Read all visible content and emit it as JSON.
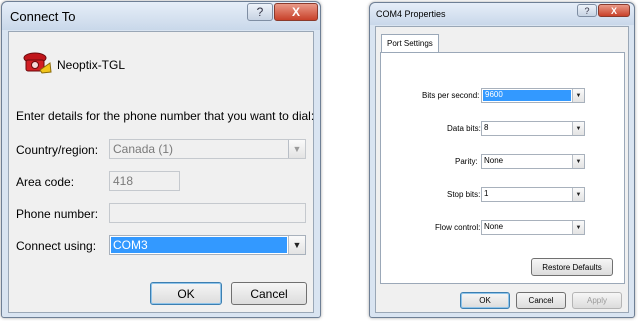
{
  "connect_dialog": {
    "title": "Connect To",
    "help_label": "?",
    "close_label": "X",
    "connection_name": "Neoptix-TGL",
    "instructions": "Enter details for the phone number that you want to dial:",
    "country_label": "Country/region:",
    "country_value": "Canada (1)",
    "area_label": "Area code:",
    "area_value": "418",
    "phone_label": "Phone number:",
    "phone_value": "",
    "connect_label": "Connect using:",
    "connect_value": "COM3",
    "ok_label": "OK",
    "cancel_label": "Cancel"
  },
  "com_properties": {
    "title": "COM4 Properties",
    "help_label": "?",
    "close_label": "X",
    "tab_label": "Port Settings",
    "bits_label": "Bits per second:",
    "bits_value": "9600",
    "databits_label": "Data bits:",
    "databits_value": "8",
    "parity_label": "Parity:",
    "parity_value": "None",
    "stopbits_label": "Stop bits:",
    "stopbits_value": "1",
    "flow_label": "Flow control:",
    "flow_value": "None",
    "restore_label": "Restore Defaults",
    "ok_label": "OK",
    "cancel_label": "Cancel",
    "apply_label": "Apply"
  }
}
